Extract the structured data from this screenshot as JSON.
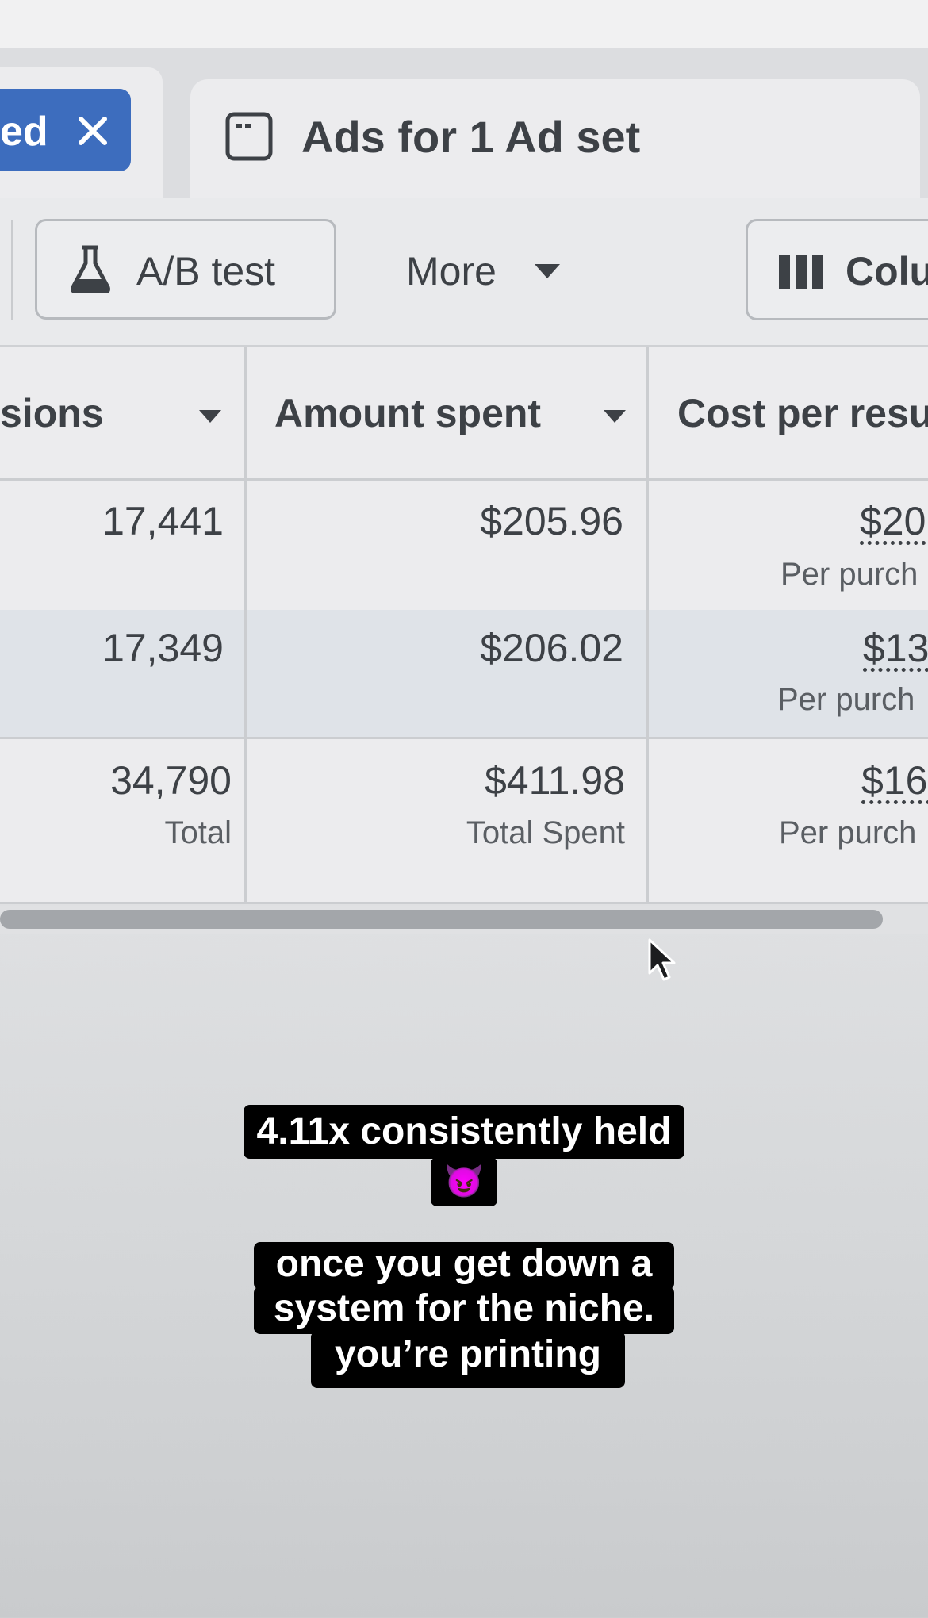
{
  "tabs": {
    "filter_chip": {
      "label": "ed",
      "close_icon": "close-icon"
    },
    "ads_tab": {
      "icon": "window-icon",
      "label": "Ads for 1 Ad set"
    }
  },
  "toolbar": {
    "ab_test": {
      "icon": "flask-icon",
      "label": "A/B test"
    },
    "more": {
      "label": "More",
      "icon": "caret-down-icon"
    },
    "columns": {
      "icon": "columns-icon",
      "label": "Colu"
    }
  },
  "table": {
    "headers": [
      {
        "label": "sions",
        "icon": "caret-down-icon"
      },
      {
        "label": "Amount spent",
        "icon": "caret-down-icon"
      },
      {
        "label": "Cost per resul"
      }
    ],
    "rows": [
      {
        "impressions": "17,441",
        "amount_spent": "$205.96",
        "cost_per_result": "$20",
        "cost_sub": "Per purch"
      },
      {
        "impressions": "17,349",
        "amount_spent": "$206.02",
        "cost_per_result": "$13",
        "cost_sub": "Per purch"
      }
    ],
    "total": {
      "impressions": "34,790",
      "impressions_sub": "Total",
      "amount_spent": "$411.98",
      "amount_spent_sub": "Total Spent",
      "cost_per_result": "$16.",
      "cost_sub": "Per purch"
    }
  },
  "captions": {
    "line1": "4.11x consistently held",
    "emoji": "😈",
    "line2": "once you get down a",
    "line3": "system for the niche.",
    "line4": "you’re printing"
  },
  "colors": {
    "chip_blue": "#3d6dbe",
    "row_highlight": "#dfe3e8",
    "caption_bg": "#000000"
  }
}
